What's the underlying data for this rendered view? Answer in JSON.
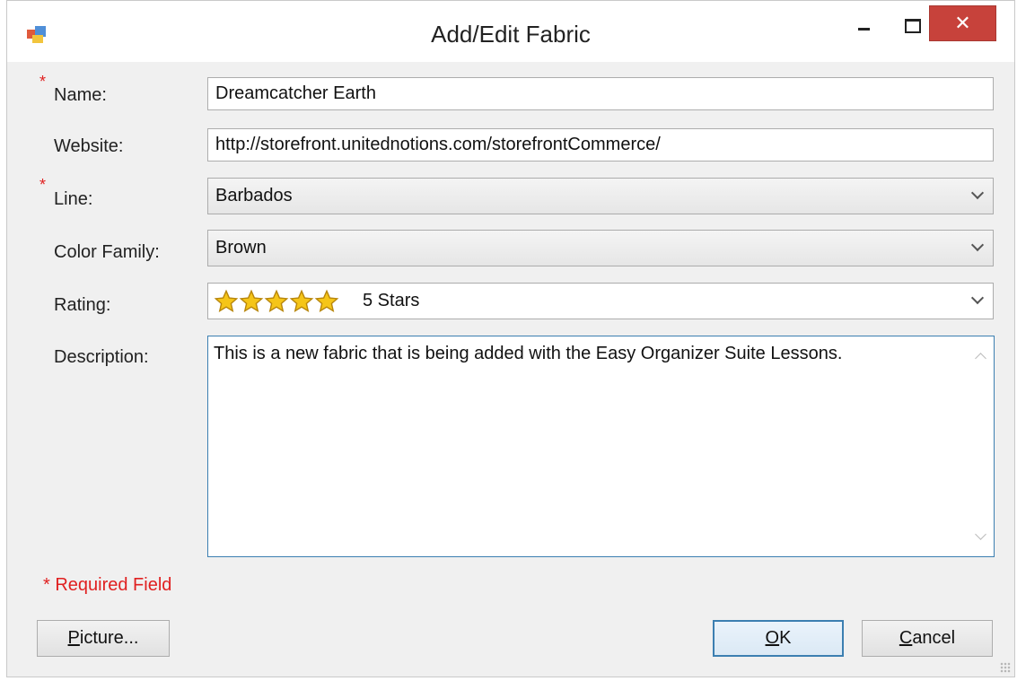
{
  "window": {
    "title": "Add/Edit Fabric",
    "minimize_icon": "minimize-icon",
    "maximize_icon": "maximize-icon",
    "close_icon": "close-icon",
    "close_glyph": "✕",
    "close_color": "#c7423b"
  },
  "form": {
    "required_star": "*",
    "name_label": "Name:",
    "name_value": "Dreamcatcher Earth",
    "website_label": "Website:",
    "website_value": "http://storefront.unitednotions.com/storefrontCommerce/",
    "line_label": "Line:",
    "line_value": "Barbados",
    "color_family_label": "Color Family:",
    "color_family_value": "Brown",
    "rating_label": "Rating:",
    "rating_value": "5 Stars",
    "rating_stars": 5,
    "description_label": "Description:",
    "description_value": "This is a new fabric that is being added with the Easy Organizer Suite Lessons.",
    "required_note": "* Required Field"
  },
  "buttons": {
    "picture_underline": "P",
    "picture_rest": "icture...",
    "ok_underline": "O",
    "ok_rest": "K",
    "cancel_underline": "C",
    "cancel_rest": "ancel"
  },
  "colors": {
    "required": "#e02020",
    "focus_border": "#3c7fb1",
    "star_fill": "#f5c518"
  }
}
